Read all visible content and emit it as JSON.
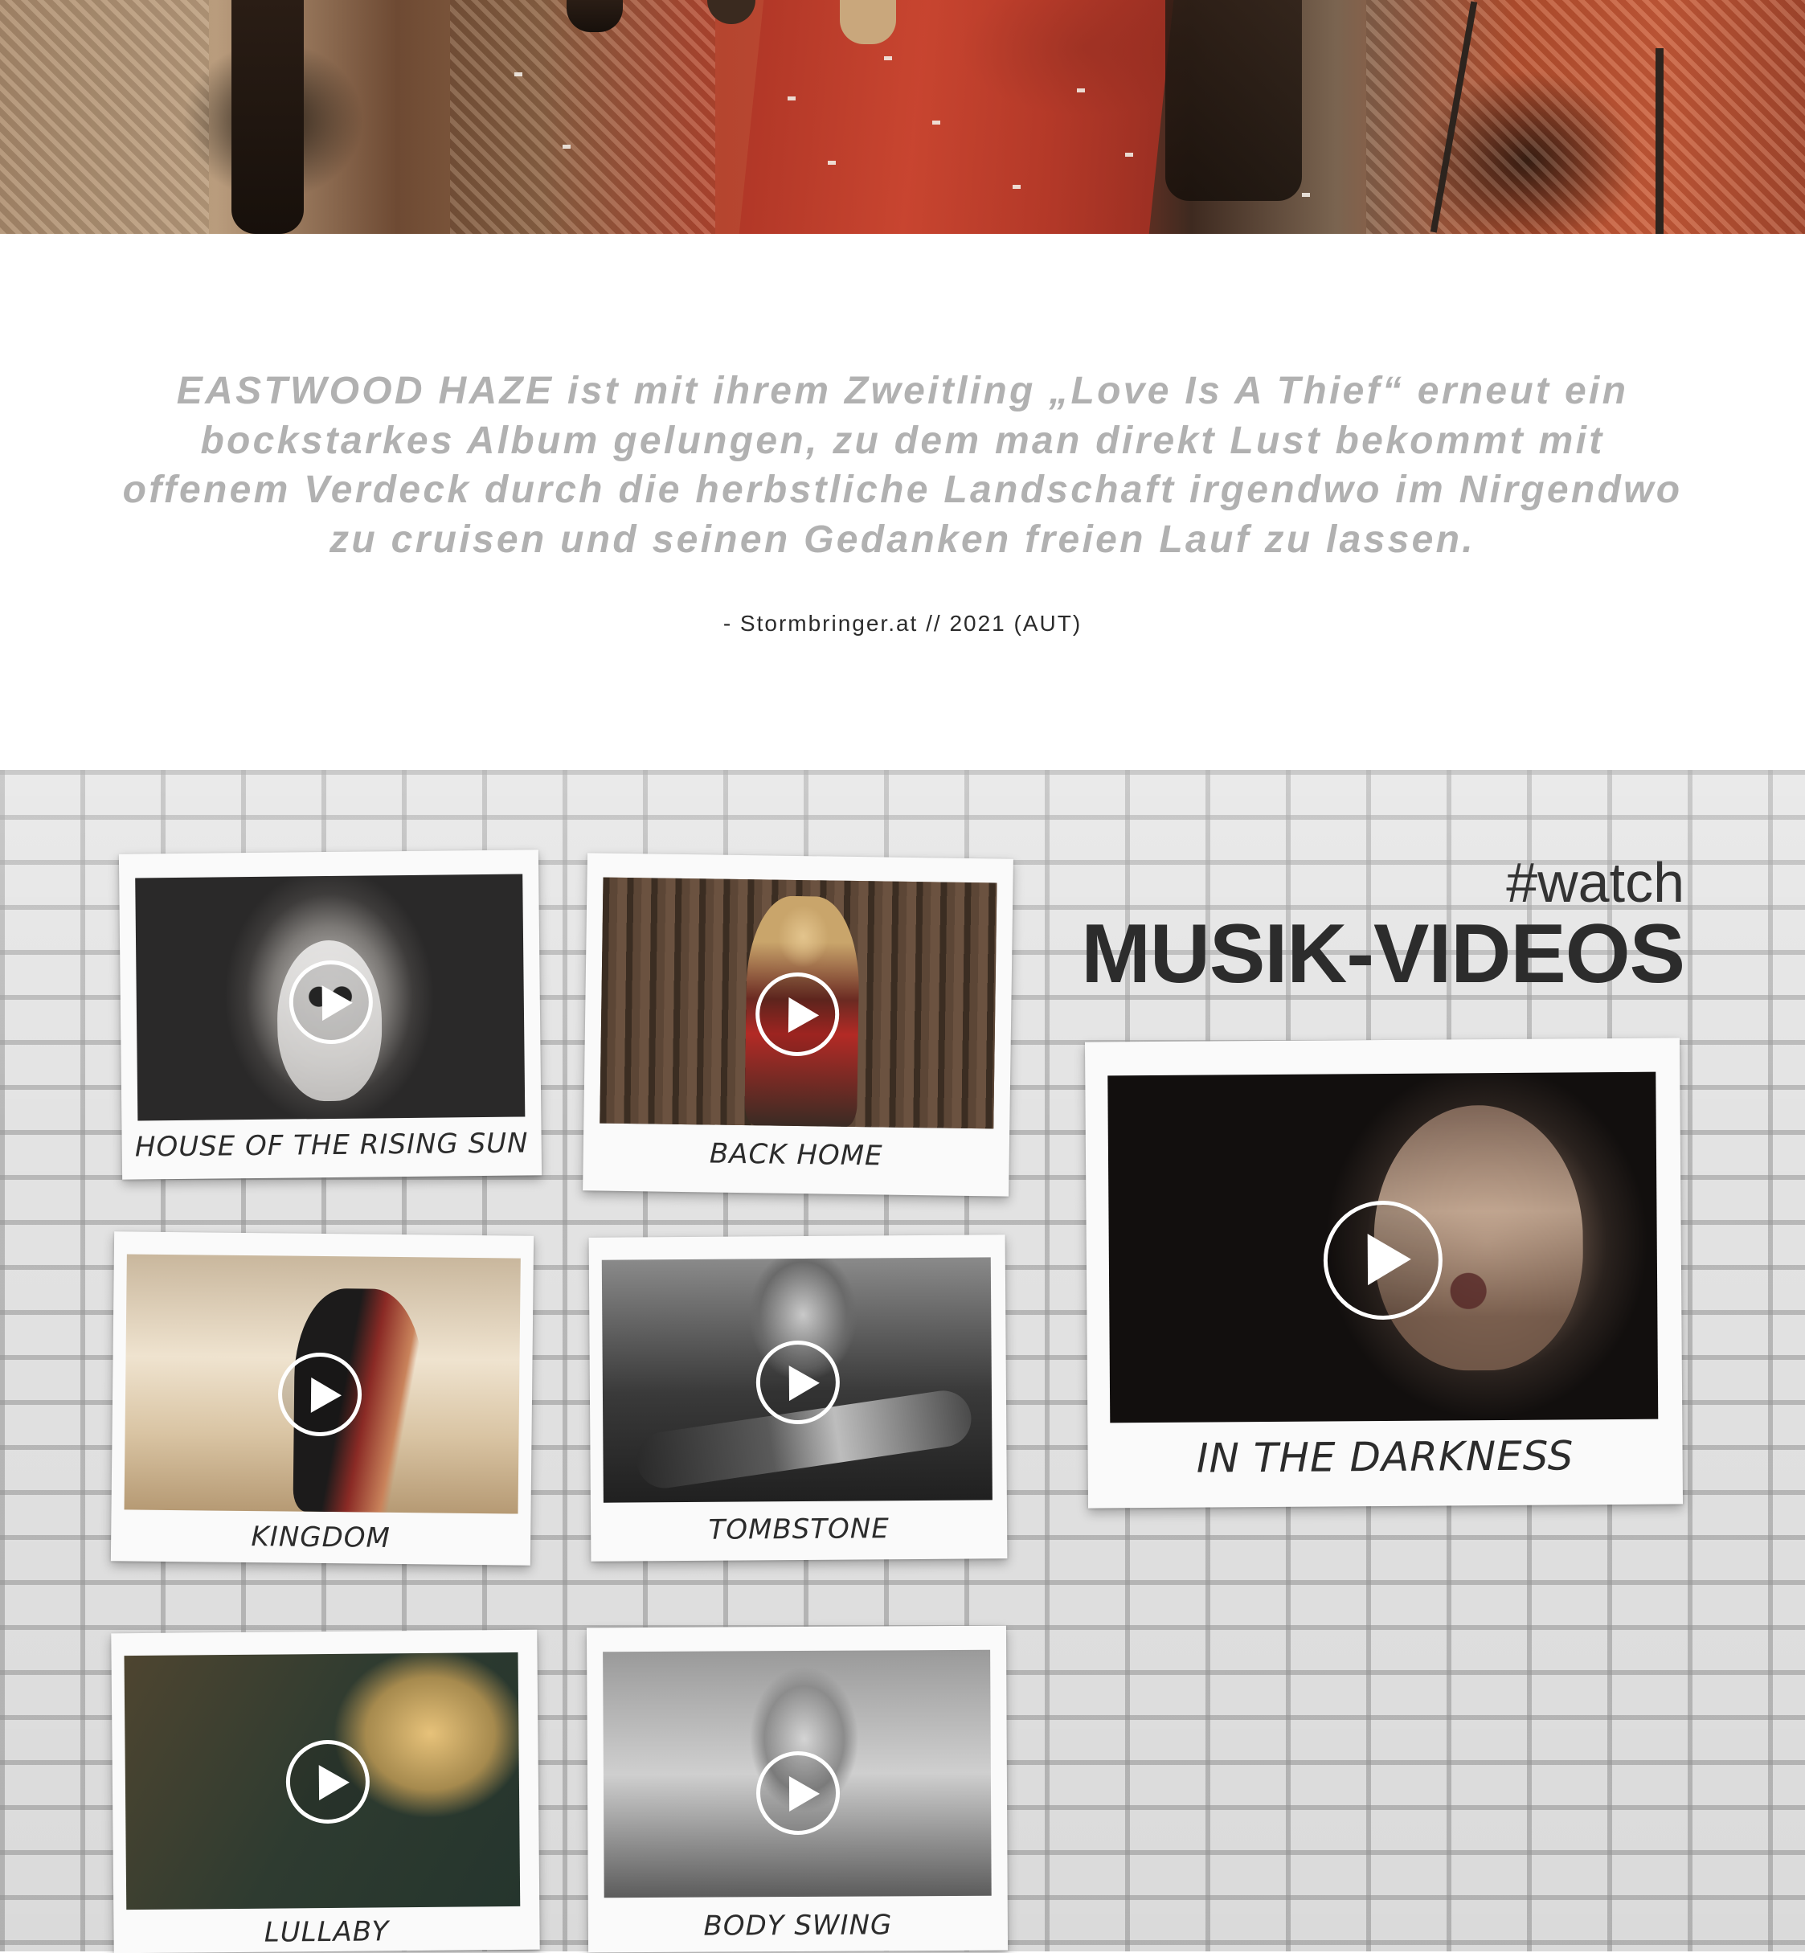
{
  "quote": {
    "text": "EASTWOOD HAZE ist mit ihrem Zweitling „Love Is A Thief“ erneut ein bockstarkes Album gelungen, zu dem man direkt Lust bekommt mit offenem Verdeck durch die herbstliche Landschaft irgendwo im Nirgendwo zu cruisen und seinen Gedanken freien Lauf zu lassen.",
    "source": "- Stormbringer.at // 2021 (AUT)"
  },
  "videos_section": {
    "tag": "#watch",
    "title": "MUSIK-VIDEOS",
    "videos": [
      {
        "title": "HOUSE OF THE RISING SUN"
      },
      {
        "title": "BACK HOME"
      },
      {
        "title": "KINGDOM"
      },
      {
        "title": "TOMBSTONE"
      },
      {
        "title": "LULLABY"
      },
      {
        "title": "BODY SWING"
      },
      {
        "title": "IN THE DARKNESS"
      }
    ]
  },
  "colors": {
    "quote_text": "#b1b1b1",
    "heading": "#2c2c2c",
    "wall": "#e3e3e3",
    "polaroid": "#fafafa"
  },
  "icons": [
    "play-icon"
  ]
}
